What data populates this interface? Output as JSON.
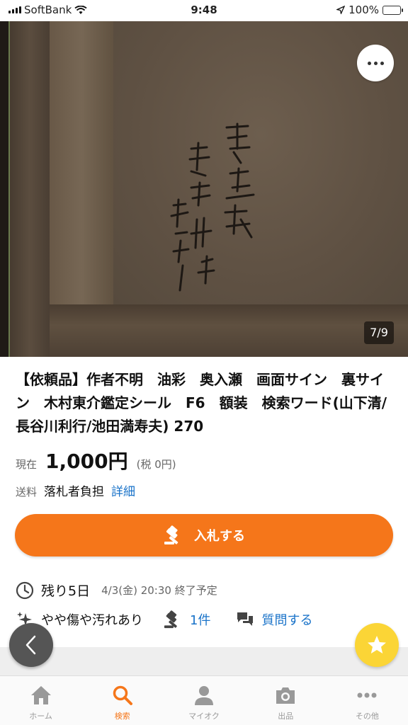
{
  "status_bar": {
    "carrier": "SoftBank",
    "time": "9:48",
    "battery": "100%"
  },
  "gallery": {
    "counter": "7/9"
  },
  "item": {
    "title": "【依頼品】作者不明　油彩　奥入瀬　画面サイン　裏サイン　木村東介鑑定シール　F6　額装　検索ワード(山下清/長谷川利行/池田満寿夫) 270",
    "price_label": "現在",
    "price": "1,000円",
    "tax": "(税 0円)",
    "shipping_label": "送料",
    "shipping_value": "落札者負担",
    "shipping_link": "詳細",
    "remaining": "残り5日",
    "end_time": "4/3(金) 20:30 終了予定",
    "condition": "やや傷や汚れあり",
    "bids": "1件",
    "ask": "質問する"
  },
  "actions": {
    "bid_label": "入札する"
  },
  "colors": {
    "accent": "#f5761a",
    "link": "#1a73c9",
    "star_fab": "#fbd536"
  },
  "tabbar": {
    "items": [
      {
        "label": "ホーム",
        "icon": "home-icon"
      },
      {
        "label": "検索",
        "icon": "search-icon"
      },
      {
        "label": "マイオク",
        "icon": "person-icon"
      },
      {
        "label": "出品",
        "icon": "camera-icon"
      },
      {
        "label": "その他",
        "icon": "more-icon"
      }
    ],
    "active": "検索"
  }
}
